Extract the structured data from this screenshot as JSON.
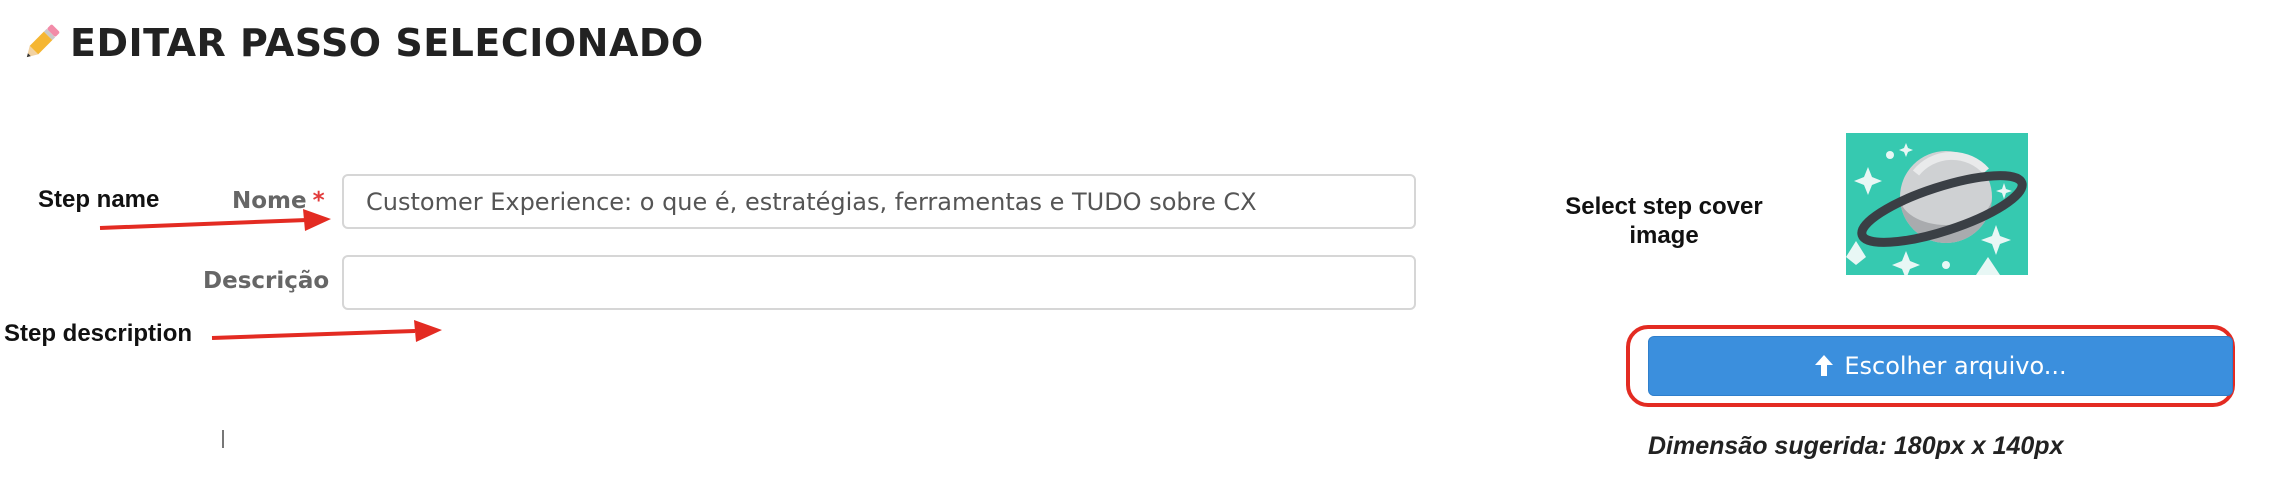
{
  "header": {
    "title": "EDITAR PASSO SELECIONADO",
    "title_icon": "pencil-icon"
  },
  "form": {
    "name_label": "Nome",
    "required_mark": "*",
    "name_value": "Customer Experience: o que é, estratégias, ferramentas e TUDO sobre CX",
    "description_label": "Descrição",
    "description_value": ""
  },
  "annotations": {
    "step_name": "Step name",
    "step_description": "Step description",
    "select_cover_line1": "Select step cover",
    "select_cover_line2": "image",
    "arrow_color": "#e32b22"
  },
  "cover": {
    "upload_icon": "upload-arrow-icon",
    "upload_label": "Escolher arquivo...",
    "suggested_dimension": "Dimensão sugerida: 180px x 140px",
    "button_color": "#3b8fdd",
    "image_bg": "#36c9b0"
  }
}
